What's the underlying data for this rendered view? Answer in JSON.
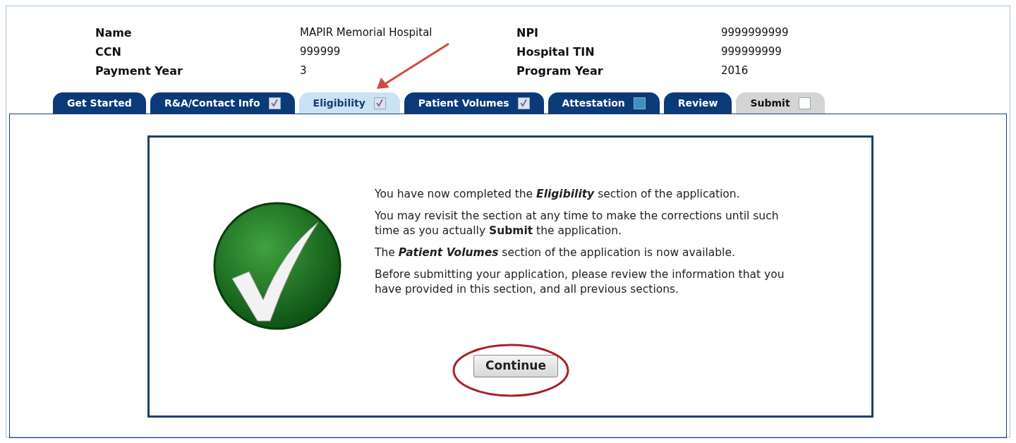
{
  "header": {
    "fields": [
      {
        "label": "Name",
        "value": "MAPIR Memorial Hospital"
      },
      {
        "label": "NPI",
        "value": "9999999999"
      },
      {
        "label": "CCN",
        "value": "999999"
      },
      {
        "label": "Hospital TIN",
        "value": "999999999"
      },
      {
        "label": "Payment Year",
        "value": "3"
      },
      {
        "label": "Program Year",
        "value": "2016"
      }
    ]
  },
  "tabs": [
    {
      "label": "Get Started",
      "kind": "plain",
      "selected": false,
      "disabled": false
    },
    {
      "label": "R&A/Contact Info",
      "kind": "checkbox",
      "checked": true,
      "selected": false,
      "disabled": false
    },
    {
      "label": "Eligibility",
      "kind": "checkbox",
      "checked": true,
      "selected": true,
      "disabled": false
    },
    {
      "label": "Patient Volumes",
      "kind": "checkbox",
      "checked": true,
      "selected": false,
      "disabled": false
    },
    {
      "label": "Attestation",
      "kind": "checkbox",
      "checked": false,
      "selected": false,
      "disabled": false
    },
    {
      "label": "Review",
      "kind": "plain",
      "selected": false,
      "disabled": false
    },
    {
      "label": "Submit",
      "kind": "checkbox",
      "checked": false,
      "selected": false,
      "disabled": true
    }
  ],
  "message": {
    "paragraphs": [
      "You have now completed the *Eligibility* section of the application.",
      "You may revisit the section at any time to make the corrections until such time as you actually **Submit** the application.",
      "The *Patient Volumes* section of the application is now available.",
      "Before submitting your application, please review the information that you have provided in this section, and all previous sections."
    ],
    "button": "Continue"
  }
}
